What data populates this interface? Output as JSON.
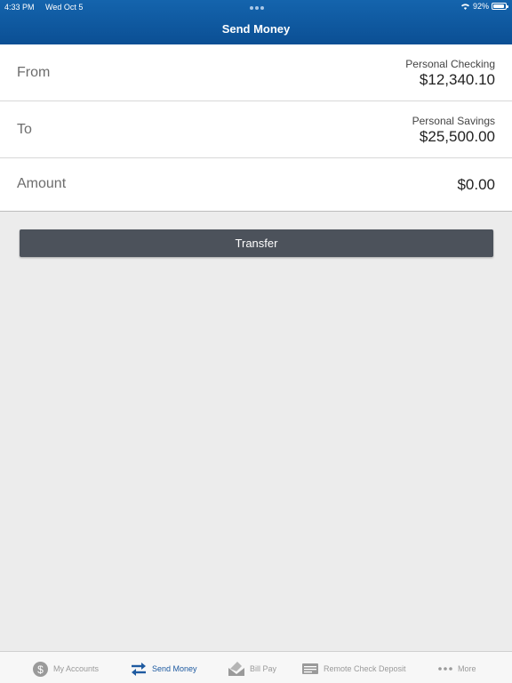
{
  "status": {
    "time": "4:33 PM",
    "date": "Wed Oct 5",
    "battery": "92%"
  },
  "header": {
    "title": "Send Money"
  },
  "form": {
    "from": {
      "label": "From",
      "account": "Personal Checking",
      "amount": "$12,340.10"
    },
    "to": {
      "label": "To",
      "account": "Personal Savings",
      "amount": "$25,500.00"
    },
    "amount": {
      "label": "Amount",
      "value": "$0.00"
    }
  },
  "transfer_button": "Transfer",
  "tabs": [
    {
      "label": "My Accounts",
      "icon": "dollar-icon"
    },
    {
      "label": "Send Money",
      "icon": "transfer-arrows-icon"
    },
    {
      "label": "Bill Pay",
      "icon": "bill-envelope-icon"
    },
    {
      "label": "Remote Check Deposit",
      "icon": "check-icon"
    },
    {
      "label": "More",
      "icon": "more-dots-icon"
    }
  ],
  "colors": {
    "header": "#0b4f94",
    "accent": "#1e5aa0",
    "button": "#4c525b"
  }
}
